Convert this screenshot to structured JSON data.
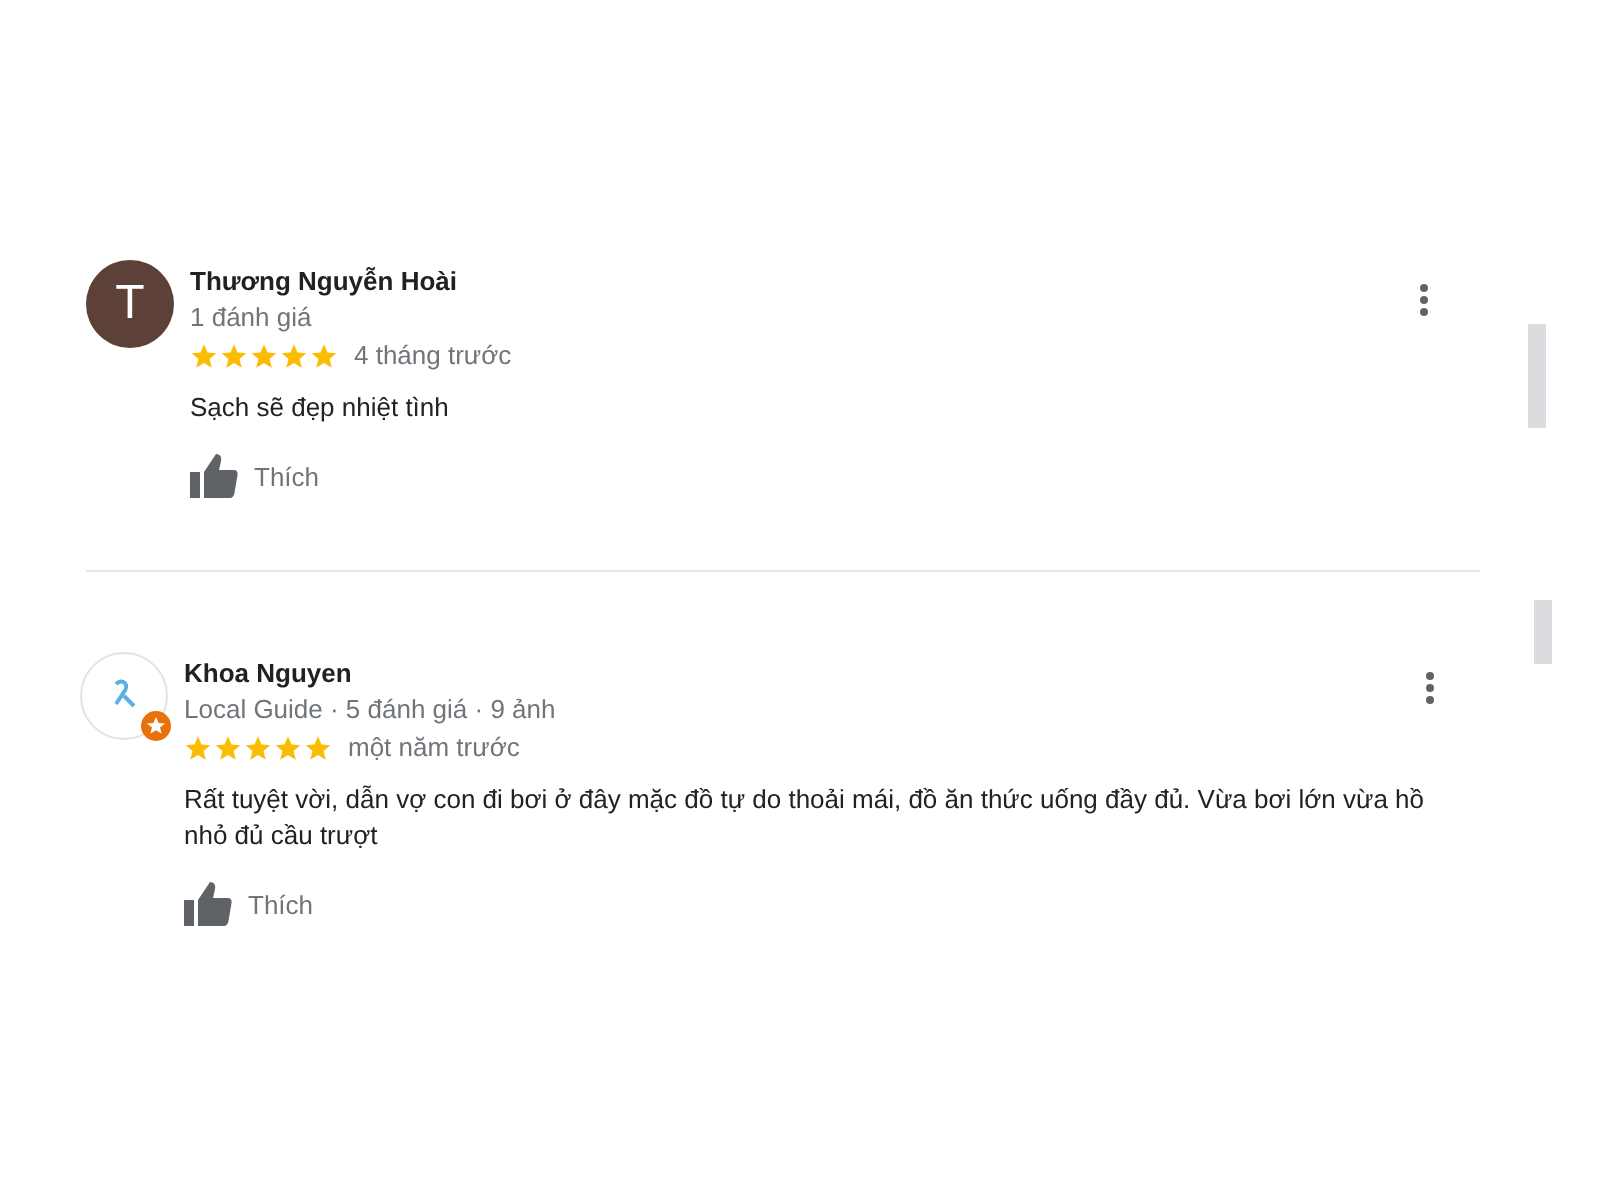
{
  "reviews": [
    {
      "avatar": {
        "kind": "letter",
        "letter": "T",
        "color": "#5d4037"
      },
      "name": "Thương Nguyễn Hoài",
      "meta": "1 đánh giá",
      "stars": 5,
      "time": "4 tháng trước",
      "text": "Sạch sẽ đẹp nhiệt tình",
      "like_label": "Thích"
    },
    {
      "avatar": {
        "kind": "guide"
      },
      "name": "Khoa Nguyen",
      "meta": "Local Guide · 5 đánh giá · 9 ảnh",
      "stars": 5,
      "time": "một năm trước",
      "text": "Rất tuyệt vời, dẫn vợ con đi bơi ở đây mặc đồ tự do thoải mái, đồ ăn thức uống đầy đủ. Vừa bơi lớn vừa hồ nhỏ đủ cầu trượt",
      "like_label": "Thích"
    }
  ]
}
